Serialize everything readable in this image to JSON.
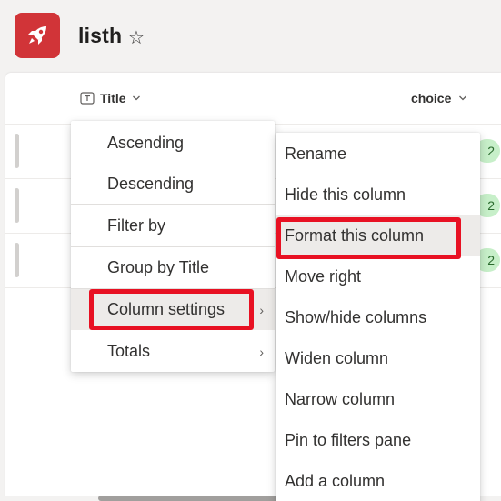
{
  "header": {
    "list_title": "listh",
    "favorite_icon": "star-outline-icon",
    "logo_icon": "rocket-icon",
    "logo_color": "#d13438"
  },
  "columns": {
    "title": {
      "label": "Title",
      "type_icon": "text-column-icon",
      "sort_icon": "chevron-down-icon"
    },
    "choice": {
      "label": "choice",
      "sort_icon": "chevron-down-icon"
    }
  },
  "rows": [
    {
      "choice_value": "2"
    },
    {
      "choice_value": "2"
    },
    {
      "choice_value": "2"
    }
  ],
  "column_menu": {
    "items": [
      {
        "label": "Ascending"
      },
      {
        "label": "Descending"
      },
      {
        "label": "Filter by"
      },
      {
        "label": "Group by Title"
      },
      {
        "label": "Column settings",
        "has_submenu": true,
        "active": true
      },
      {
        "label": "Totals",
        "has_submenu": true
      }
    ]
  },
  "column_settings_menu": {
    "items": [
      {
        "label": "Rename"
      },
      {
        "label": "Hide this column"
      },
      {
        "label": "Format this column",
        "highlighted": true
      },
      {
        "label": "Move right"
      },
      {
        "label": "Show/hide columns"
      },
      {
        "label": "Widen column"
      },
      {
        "label": "Narrow column"
      },
      {
        "label": "Pin to filters pane"
      },
      {
        "label": "Add a column"
      }
    ]
  },
  "colors": {
    "highlight": "#e81123",
    "choice_pill_bg": "#c7efc9",
    "menu_hover": "#edebe9"
  }
}
